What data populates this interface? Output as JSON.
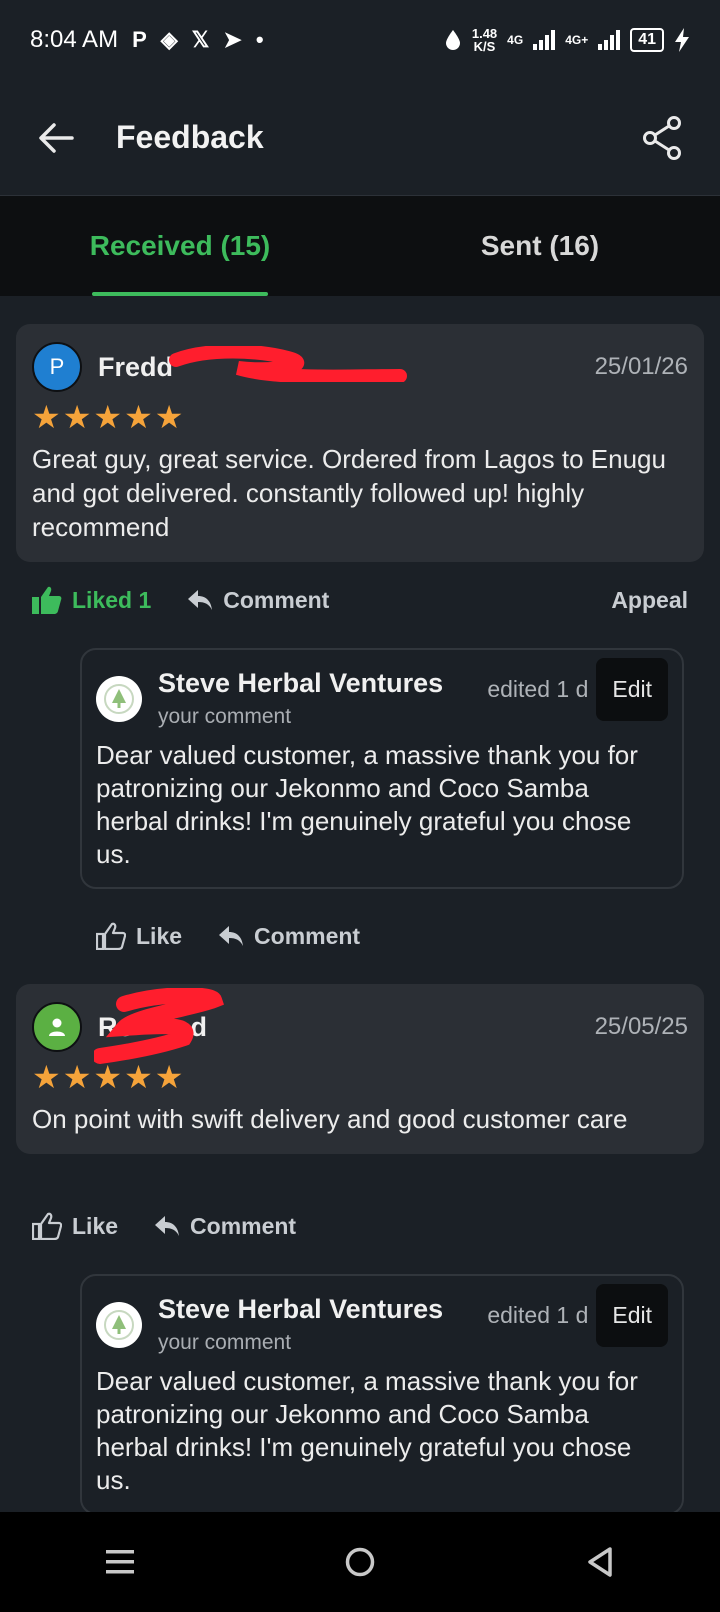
{
  "status": {
    "time": "8:04 AM",
    "icons_left": [
      "P",
      "◈",
      "𝕏",
      "➤",
      "•"
    ],
    "net_speed_value": "1.48",
    "net_speed_unit": "K/S",
    "signal1": "4G",
    "signal2": "4G+",
    "battery": "41"
  },
  "appbar": {
    "title": "Feedback"
  },
  "tabs": [
    {
      "label": "Received (15)"
    },
    {
      "label": "Sent (16)"
    }
  ],
  "reviews": [
    {
      "avatar_letter": "P",
      "avatar_color": "#1f7fd1",
      "name_visible": "Fredd",
      "name_tail": "e",
      "date": "25/01/26",
      "stars": "★★★★★",
      "text": "Great guy, great service. Ordered from Lagos to Enugu and got delivered. constantly followed up! highly recommend",
      "like_label": "Liked 1",
      "comment_label": "Comment",
      "appeal_label": "Appeal",
      "reply": {
        "business": "Steve Herbal Ventures",
        "sub": "your comment",
        "edited": "edited 1 d",
        "edit_label": "Edit",
        "text": "Dear valued customer, a massive thank you for patronizing our Jekonmo and Coco Samba herbal drinks! I'm genuinely grateful you chose us.",
        "like_label": "Like",
        "comment_label": "Comment"
      }
    },
    {
      "avatar_color": "#5bb043",
      "name_visible": "Re",
      "name_tail": "d",
      "date": "25/05/25",
      "stars": "★★★★★",
      "text": "On point with swift delivery and good customer care",
      "like_label": "Like",
      "comment_label": "Comment",
      "reply": {
        "business": "Steve Herbal Ventures",
        "sub": "your comment",
        "edited": "edited 1 d",
        "edit_label": "Edit",
        "text": "Dear valued customer, a massive thank you for patronizing our Jekonmo and Coco Samba herbal drinks! I'm genuinely grateful you chose us."
      }
    }
  ],
  "colors": {
    "accent": "#3dbb5c",
    "star": "#f5a33a",
    "redaction": "#ff1e2d"
  }
}
